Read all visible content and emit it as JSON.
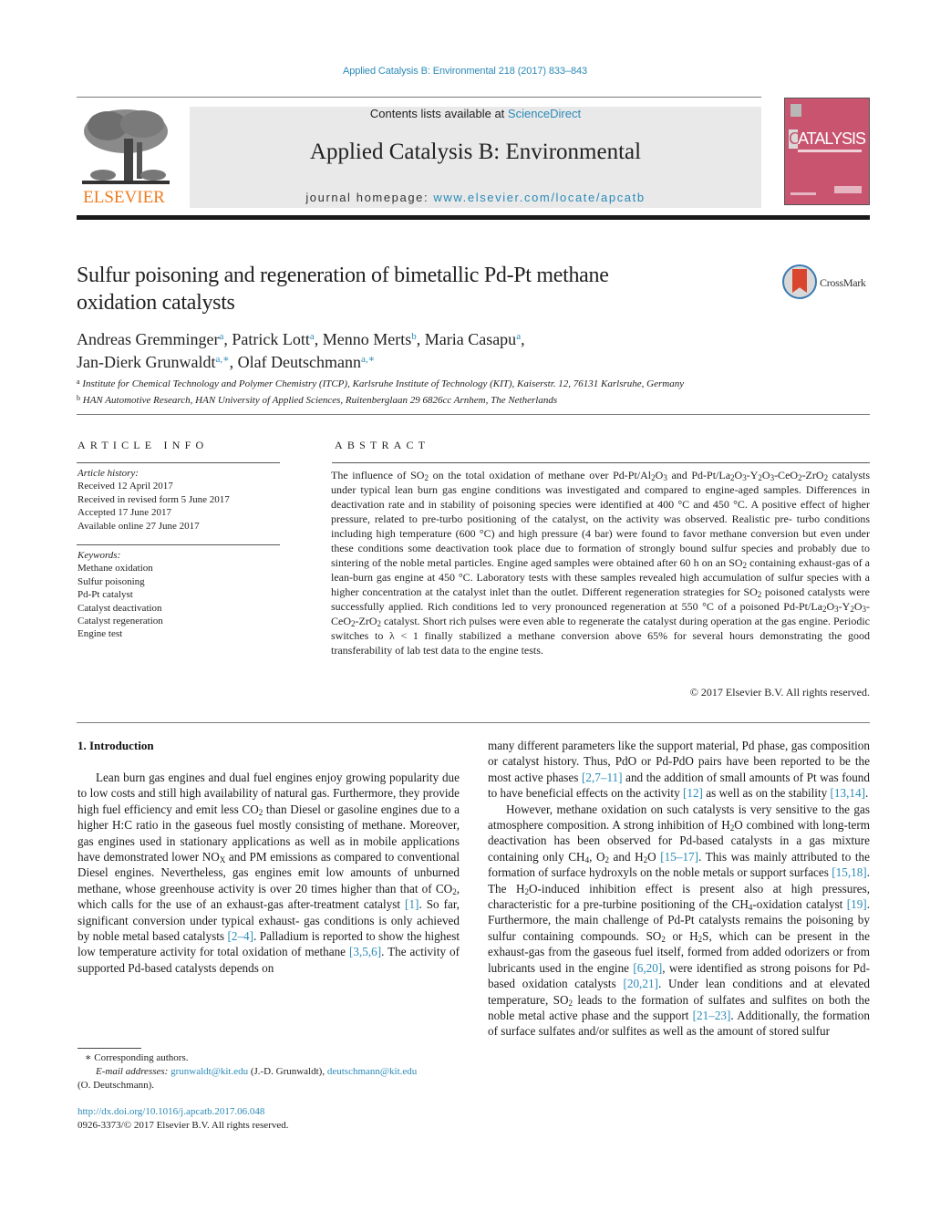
{
  "header": {
    "journal_ref": "Applied Catalysis B: Environmental 218 (2017) 833–843",
    "publisher_logo_text": "ELSEVIER",
    "contents_prefix": "Contents lists available at ",
    "contents_link": "ScienceDirect",
    "journal_title": "Applied Catalysis B: Environmental",
    "homepage_prefix": "journal homepage: ",
    "homepage_link": "www.elsevier.com/locate/apcatb",
    "cover_title": "CATALYSIS",
    "cover_title_initial": "C",
    "colors": {
      "link": "#2a8ab8",
      "elsevier_orange": "#f07c1f",
      "cover_pink": "#c85470"
    }
  },
  "article": {
    "title_line1": "Sulfur poisoning and regeneration of bimetallic Pd-Pt methane",
    "title_line2": "oxidation catalysts",
    "crossmark_label": "CrossMark",
    "authors": [
      {
        "name": "Andreas Gremminger",
        "aff": "a"
      },
      {
        "name": "Patrick Lott",
        "aff": "a"
      },
      {
        "name": "Menno Merts",
        "aff": "b"
      },
      {
        "name": "Maria Casapu",
        "aff": "a"
      },
      {
        "name": "Jan-Dierk Grunwaldt",
        "aff": "a,∗"
      },
      {
        "name": "Olaf Deutschmann",
        "aff": "a,∗"
      }
    ],
    "affiliations": [
      {
        "key": "a",
        "text": "Institute for Chemical Technology and Polymer Chemistry (ITCP), Karlsruhe Institute of Technology (KIT), Kaiserstr. 12, 76131 Karlsruhe, Germany"
      },
      {
        "key": "b",
        "text": "HAN Automotive Research, HAN University of Applied Sciences, Ruitenberglaan 29 6826cc Arnhem, The Netherlands"
      }
    ]
  },
  "article_info": {
    "heading": "ARTICLE INFO",
    "history_label": "Article history:",
    "history": [
      "Received 12 April 2017",
      "Received in revised form 5 June 2017",
      "Accepted 17 June 2017",
      "Available online 27 June 2017"
    ],
    "keywords_label": "Keywords:",
    "keywords": [
      "Methane oxidation",
      "Sulfur poisoning",
      "Pd-Pt catalyst",
      "Catalyst deactivation",
      "Catalyst regeneration",
      "Engine test"
    ]
  },
  "abstract": {
    "heading": "ABSTRACT",
    "copyright": "© 2017 Elsevier B.V. All rights reserved."
  },
  "intro": {
    "heading": "1.  Introduction",
    "refs": {
      "r1": "[1]",
      "r2_4": "[2–4]",
      "r3_5_6": "[3,5,6]",
      "r2_7_11": "[2,7–11]",
      "r12": "[12]",
      "r13_14": "[13,14]",
      "r15_17": "[15–17]",
      "r15_18": "[15,18]",
      "r19": "[19]",
      "r6_20": "[6,20]",
      "r20_21": "[20,21]",
      "r21_23": "[21–23]"
    }
  },
  "footnotes": {
    "corresponding": "∗  Corresponding authors.",
    "email_label": "E-mail addresses:",
    "email1": "grunwaldt@kit.edu",
    "email1_owner": " (J.-D. Grunwaldt), ",
    "email2": "deutschmann@kit.edu",
    "email2_owner": "(O. Deutschmann).",
    "doi": "http://dx.doi.org/10.1016/j.apcatb.2017.06.048",
    "issn": "0926-3373/© 2017 Elsevier B.V. All rights reserved."
  }
}
